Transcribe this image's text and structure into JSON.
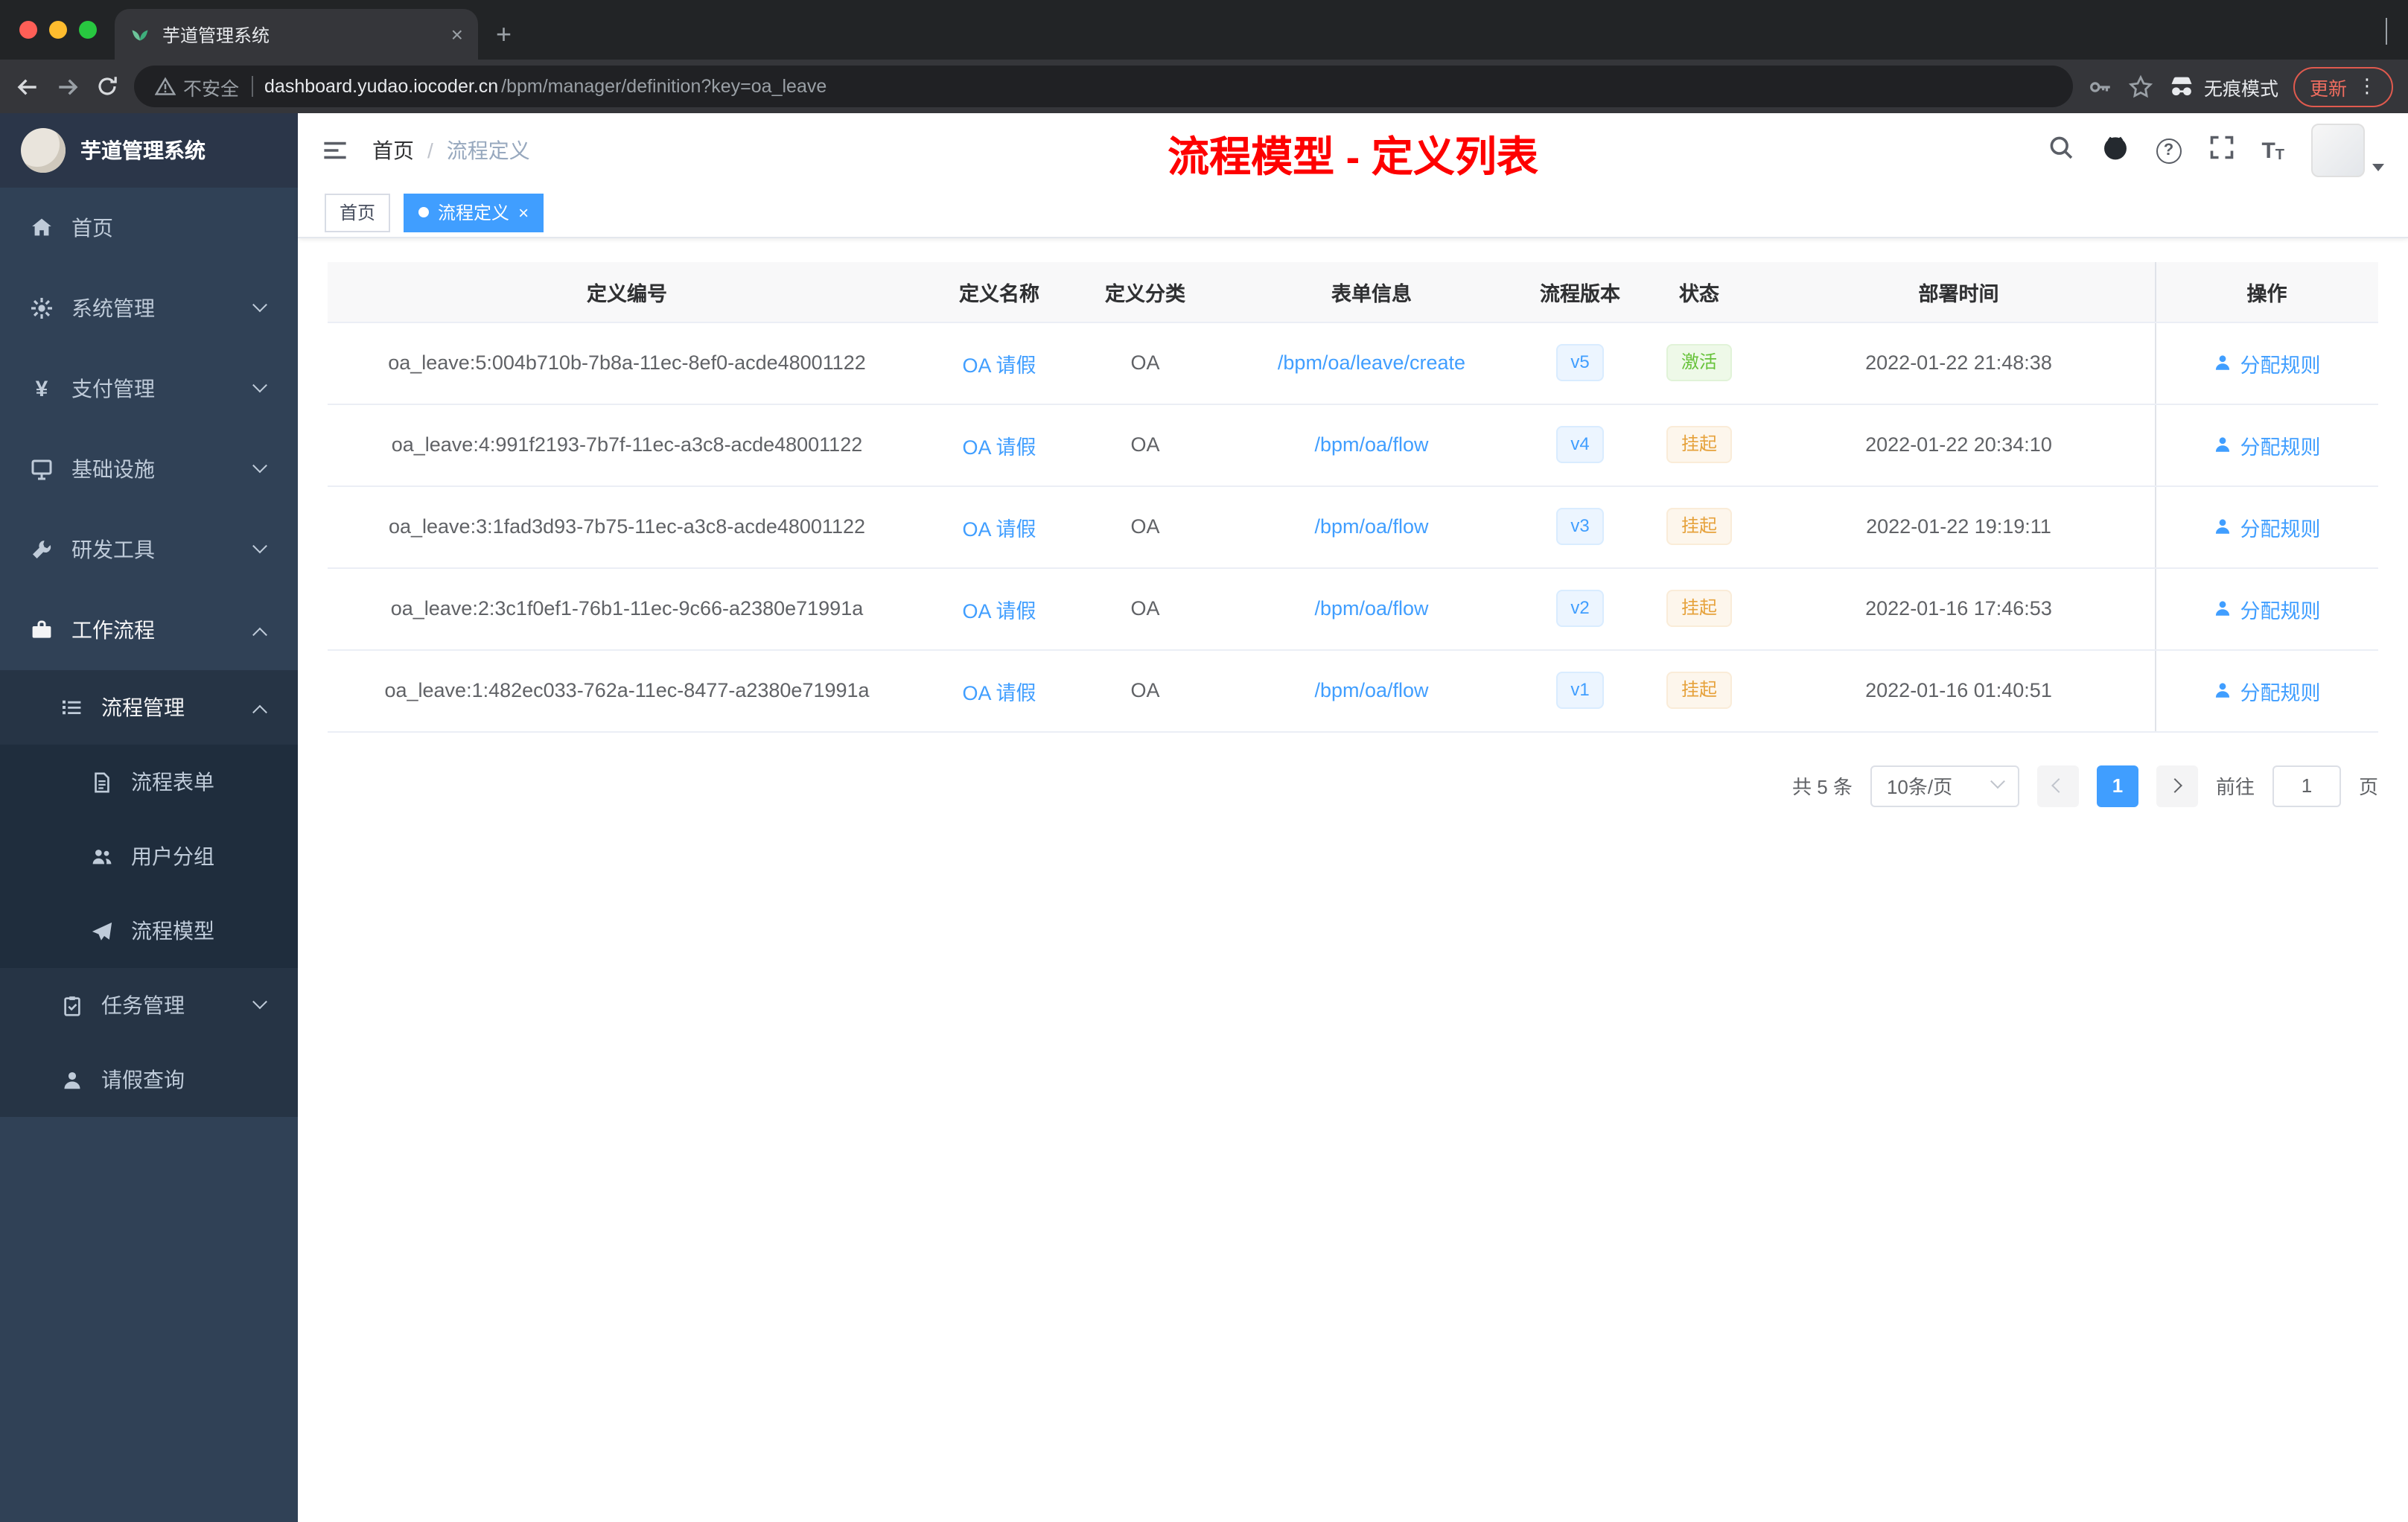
{
  "browser": {
    "tab_title": "芋道管理系统",
    "tab_close": "×",
    "new_tab": "+",
    "security_label": "不安全",
    "url_domain": "dashboard.yudao.iocoder.cn",
    "url_path": "/bpm/manager/definition?key=oa_leave",
    "incognito_label": "无痕模式",
    "update_label": "更新",
    "menu_dots": "⋮"
  },
  "sidebar": {
    "app_title": "芋道管理系统",
    "menu": [
      {
        "label": "首页"
      },
      {
        "label": "系统管理"
      },
      {
        "label": "支付管理"
      },
      {
        "label": "基础设施"
      },
      {
        "label": "研发工具"
      },
      {
        "label": "工作流程"
      },
      {
        "label": "流程管理"
      },
      {
        "label": "流程表单"
      },
      {
        "label": "用户分组"
      },
      {
        "label": "流程模型"
      },
      {
        "label": "任务管理"
      },
      {
        "label": "请假查询"
      }
    ],
    "yen_icon": "¥"
  },
  "navbar": {
    "breadcrumb_home": "首页",
    "breadcrumb_sep": "/",
    "breadcrumb_current": "流程定义",
    "annotation": "流程模型 - 定义列表",
    "question_mark": "?",
    "fontsize_big": "T",
    "fontsize_small": "T"
  },
  "tags": {
    "home": "首页",
    "active": "流程定义",
    "close": "×"
  },
  "table": {
    "columns": [
      "定义编号",
      "定义名称",
      "定义分类",
      "表单信息",
      "流程版本",
      "状态",
      "部署时间",
      "操作"
    ],
    "rows": [
      {
        "id": "oa_leave:5:004b710b-7b8a-11ec-8ef0-acde48001122",
        "name": "OA 请假",
        "category": "OA",
        "form": "/bpm/oa/leave/create",
        "version": "v5",
        "status": "激活",
        "time": "2022-01-22 21:48:38",
        "action": "分配规则"
      },
      {
        "id": "oa_leave:4:991f2193-7b7f-11ec-a3c8-acde48001122",
        "name": "OA 请假",
        "category": "OA",
        "form": "/bpm/oa/flow",
        "version": "v4",
        "status": "挂起",
        "time": "2022-01-22 20:34:10",
        "action": "分配规则"
      },
      {
        "id": "oa_leave:3:1fad3d93-7b75-11ec-a3c8-acde48001122",
        "name": "OA 请假",
        "category": "OA",
        "form": "/bpm/oa/flow",
        "version": "v3",
        "status": "挂起",
        "time": "2022-01-22 19:19:11",
        "action": "分配规则"
      },
      {
        "id": "oa_leave:2:3c1f0ef1-76b1-11ec-9c66-a2380e71991a",
        "name": "OA 请假",
        "category": "OA",
        "form": "/bpm/oa/flow",
        "version": "v2",
        "status": "挂起",
        "time": "2022-01-16 17:46:53",
        "action": "分配规则"
      },
      {
        "id": "oa_leave:1:482ec033-762a-11ec-8477-a2380e71991a",
        "name": "OA 请假",
        "category": "OA",
        "form": "/bpm/oa/flow",
        "version": "v1",
        "status": "挂起",
        "time": "2022-01-16 01:40:51",
        "action": "分配规则"
      }
    ]
  },
  "pagination": {
    "total": "共 5 条",
    "page_size": "10条/页",
    "current_page": "1",
    "goto_label": "前往",
    "goto_value": "1",
    "page_unit": "页"
  },
  "colors": {
    "accent": "#409eff",
    "success": "#67c23a",
    "warning": "#e6a23c",
    "annotation_red": "#fe0000",
    "sidebar_bg": "#304156"
  }
}
